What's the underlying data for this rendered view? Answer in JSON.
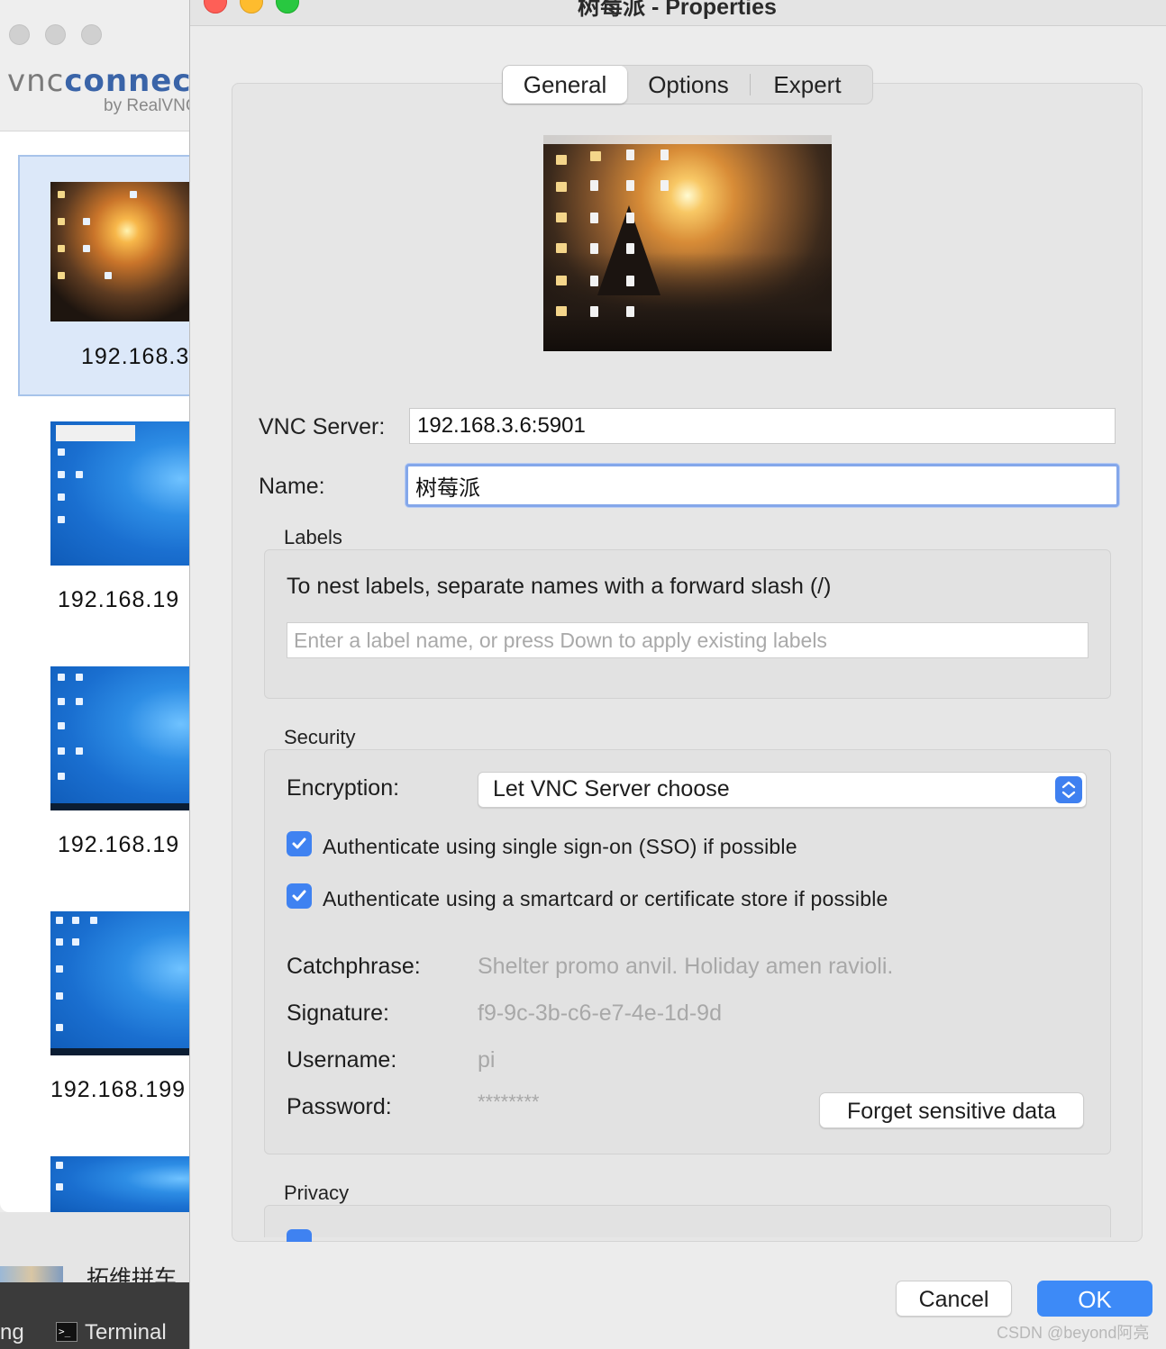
{
  "background_window": {
    "logo_vnc": "vnc",
    "logo_connect": "connect",
    "logo_sub": "by RealVNC",
    "connections": [
      {
        "label": "192.168.3",
        "thumbnail": "sunset-desktop"
      },
      {
        "label": "192.168.19",
        "thumbnail": "windows-desktop"
      },
      {
        "label": "192.168.19",
        "thumbnail": "windows-desktop"
      },
      {
        "label": "192.168.199",
        "thumbnail": "windows-desktop"
      },
      {
        "label": "",
        "thumbnail": "windows-desktop"
      }
    ],
    "bottom_item_label": "拓维拼车",
    "dock_left_text": "ng",
    "dock_terminal_label": "Terminal",
    "terminal_icon_glyph": ">_"
  },
  "dialog": {
    "title": "树莓派 - Properties",
    "tabs": [
      "General",
      "Options",
      "Expert"
    ],
    "active_tab": "General",
    "vnc_server_label": "VNC Server:",
    "vnc_server_value": "192.168.3.6:5901",
    "name_label": "Name:",
    "name_value": "树莓派",
    "labels": {
      "section_title": "Labels",
      "hint": "To nest labels, separate names with a forward slash (/)",
      "input_placeholder": "Enter a label name, or press Down to apply existing labels"
    },
    "security": {
      "section_title": "Security",
      "encryption_label": "Encryption:",
      "encryption_value": "Let VNC Server choose",
      "sso_label": "Authenticate using single sign-on (SSO) if possible",
      "sso_checked": true,
      "smartcard_label": "Authenticate using a smartcard or certificate store if possible",
      "smartcard_checked": true,
      "catchphrase_label": "Catchphrase:",
      "catchphrase_value": "Shelter promo anvil. Holiday amen ravioli.",
      "signature_label": "Signature:",
      "signature_value": "f9-9c-3b-c6-e7-4e-1d-9d",
      "username_label": "Username:",
      "username_value": "pi",
      "password_label": "Password:",
      "password_value": "********",
      "forget_button": "Forget sensitive data"
    },
    "privacy": {
      "section_title": "Privacy"
    },
    "cancel_button": "Cancel",
    "ok_button": "OK"
  },
  "watermark": "CSDN @beyond阿亮",
  "colors": {
    "accent": "#3d8af7",
    "checkbox": "#3f82f1",
    "traffic_close": "#fe5f57",
    "traffic_min": "#febc2e",
    "traffic_max": "#28c840",
    "dimmed_text": "#a8a8a8"
  }
}
